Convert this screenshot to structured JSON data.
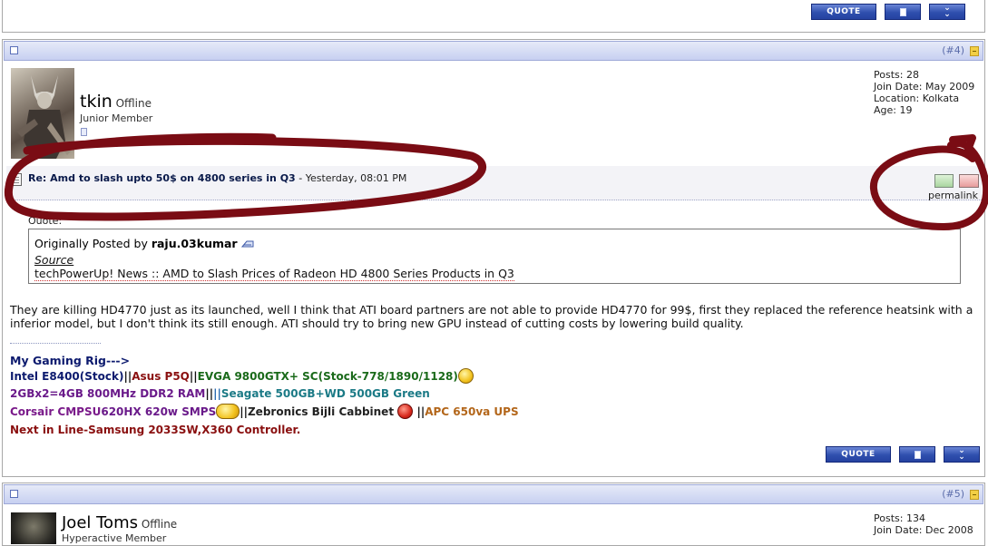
{
  "buttons": {
    "quote_label": "QUOTE"
  },
  "post4": {
    "number": "(#4)",
    "user": {
      "name": "tkin",
      "status": "Offline",
      "role": "Junior Member"
    },
    "stats": [
      "Posts: 28",
      "Join Date: May 2009",
      "Location: Kolkata",
      "Age: 19"
    ],
    "title": "Re: Amd to slash upto 50$ on 4800 series in Q3",
    "title_sep": " - ",
    "date": "Yesterday, 08:01 PM",
    "permalink": "permalink",
    "quote": {
      "label": "Quote:",
      "originally_posted_by": "Originally Posted by",
      "author": "raju.03kumar",
      "source_label": "Source",
      "link_text": "techPowerUp! News :: AMD to Slash Prices of Radeon HD 4800 Series Products in Q3"
    },
    "message": "They are killing HD4770 just as its launched, well I think that ATI board partners are not able to provide HD4770 for 99$, first they replaced the reference heatsink with a inferior model, but I don't think its still enough. ATI should try to bring new GPU instead of cutting costs by lowering build quality.",
    "signature": {
      "heading": "My Gaming Rig--->",
      "line1": {
        "a": "Intel E8400(Stock)",
        "sep1": "||",
        "b": "Asus P5Q",
        "sep2": "||",
        "c": "EVGA 9800GTX+ SC(Stock-778/1890/1128)"
      },
      "line2": {
        "a": "2GBx2=4GB 800MHz DDR2 RAM",
        "sep1": "||",
        "sep2": "||",
        "b": "Seagate 500GB+WD 500GB Green"
      },
      "line3": {
        "a": "Corsair CMPSU",
        "b": "620HX 620w SMPS",
        "sep1": "||",
        "c": "Zebronics Bijli Cabbinet",
        "sep2": "||",
        "d": "APC 650va UPS"
      },
      "line4": "Next in Line-Samsung 2033SW,X360 Controller."
    }
  },
  "post5": {
    "number": "(#5)",
    "user": {
      "name": "Joel Toms",
      "status": "Offline",
      "role": "Hyperactive Member"
    },
    "stats": [
      "Posts: 134",
      "Join Date: Dec 2008"
    ]
  },
  "colors": {
    "annotation": "#7a0c14",
    "header": "#c7d0f1",
    "button": "#2f4fae"
  }
}
